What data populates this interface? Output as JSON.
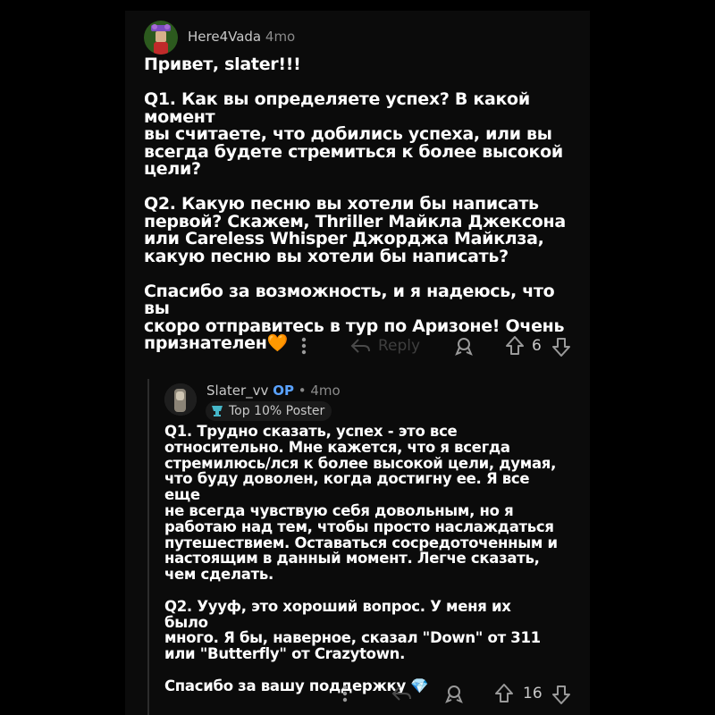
{
  "comment": {
    "author": "Here4Vada",
    "age": "4mo",
    "paragraphs": [
      "Привет, slater!!!",
      "Q1. Как вы определяете успех? В какой момент\nвы считаете, что добились успеха, или вы\nвсегда будете стремиться к более высокой\nцели?",
      "Q2. Какую песню вы хотели бы написать\nпервой? Скажем, Thriller Майкла Джексона\nили Careless Whisper Джорджа Майклза,\nкакую песню вы хотели бы написать?",
      "Спасибо за возможность, и я надеюсь, что вы\nскоро отправитесь в тур по Аризоне! Очень\nпризнателен🧡"
    ],
    "reply_label": "Reply",
    "score": "6"
  },
  "reply": {
    "author": "Slater_vv",
    "op_label": "OP",
    "age": "• 4mo",
    "badge_label": "Top 10% Poster",
    "paragraphs": [
      "Q1. Трудно сказать, успех - это все\nотносительно. Мне кажется, что я всегда\nстремилюсь/лся к более высокой цели, думая,\nчто буду доволен, когда достигну ее. Я все еще\nне всегда чувствую себя довольным, но я\nработаю над тем, чтобы просто наслаждаться\nпутешествием. Оставаться сосредоточенным и\nнастоящим в данный момент. Легче сказать,\nчем сделать.",
      "Q2. Уууф, это хороший вопрос. У меня их было\nмного. Я бы, наверное, сказал \"Down\" от 311\nили \"Butterfly\" от Crazytown.",
      "Спасибо за вашу поддержку 💎"
    ],
    "score": "16"
  },
  "icons": {
    "more": "more-vertical-icon",
    "reply": "reply-arrow-icon",
    "award": "award-icon",
    "upvote": "upvote-arrow-icon",
    "downvote": "downvote-arrow-icon"
  },
  "colors": {
    "background": "#000000",
    "panel": "#0b0b0b",
    "text": "#ffffff",
    "op": "#5aa2ff"
  }
}
